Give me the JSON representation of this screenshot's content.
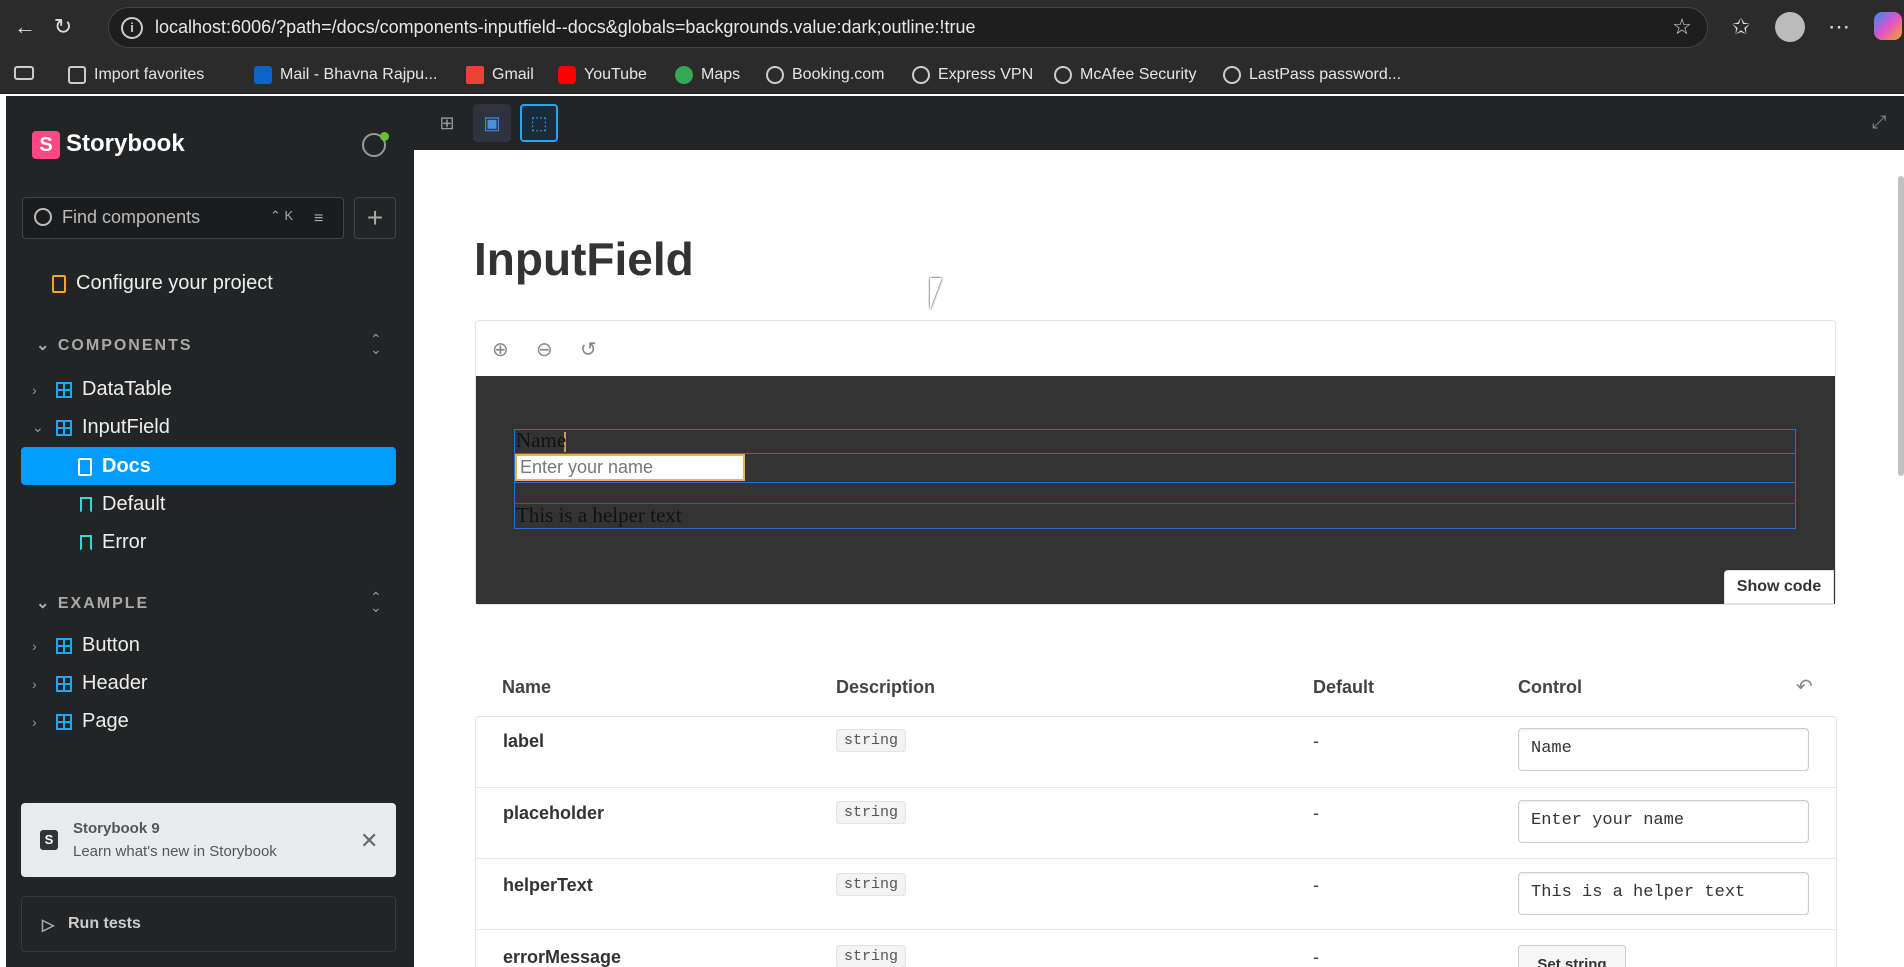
{
  "browser": {
    "url": "localhost:6006/?path=/docs/components-inputfield--docs&globals=backgrounds.value:dark;outline:!true",
    "bookmarks": [
      {
        "label": "Import favorites",
        "icon": "import-icon"
      },
      {
        "label": "Mail - Bhavna Rajpu...",
        "icon": "outlook-icon"
      },
      {
        "label": "Gmail",
        "icon": "gmail-icon"
      },
      {
        "label": "YouTube",
        "icon": "youtube-icon"
      },
      {
        "label": "Maps",
        "icon": "maps-icon"
      },
      {
        "label": "Booking.com",
        "icon": "globe-icon"
      },
      {
        "label": "Express VPN",
        "icon": "globe-icon"
      },
      {
        "label": "McAfee Security",
        "icon": "globe-icon"
      },
      {
        "label": "LastPass password...",
        "icon": "globe-icon"
      }
    ]
  },
  "sidebar": {
    "title": "Storybook",
    "search_placeholder": "Find components",
    "shortcut": "⌃ K",
    "configure": "Configure your project",
    "sections": [
      {
        "label": "COMPONENTS",
        "items": [
          "DataTable",
          "InputField"
        ]
      },
      {
        "label": "EXAMPLE",
        "items": [
          "Button",
          "Header",
          "Page"
        ]
      }
    ],
    "inputfield_children": [
      "Docs",
      "Default",
      "Error"
    ],
    "notice_title": "Storybook 9",
    "notice_sub": "Learn what's new in Storybook",
    "run_tests": "Run tests"
  },
  "main": {
    "title": "InputField",
    "preview": {
      "label": "Name",
      "placeholder": "Enter your name",
      "helper": "This is a helper text",
      "show_code": "Show code"
    },
    "table": {
      "headers": [
        "Name",
        "Description",
        "Default",
        "Control"
      ],
      "rows": [
        {
          "name": "label",
          "type": "string",
          "default": "-",
          "control": "Name"
        },
        {
          "name": "placeholder",
          "type": "string",
          "default": "-",
          "control": "Enter your name"
        },
        {
          "name": "helperText",
          "type": "string",
          "default": "-",
          "control": "This is a helper text"
        },
        {
          "name": "errorMessage",
          "type": "string",
          "default": "-",
          "control": "Set string"
        }
      ]
    }
  },
  "colors": {
    "accent": "#029cfd",
    "brand": "#ff4785",
    "canvas": "#333333"
  }
}
